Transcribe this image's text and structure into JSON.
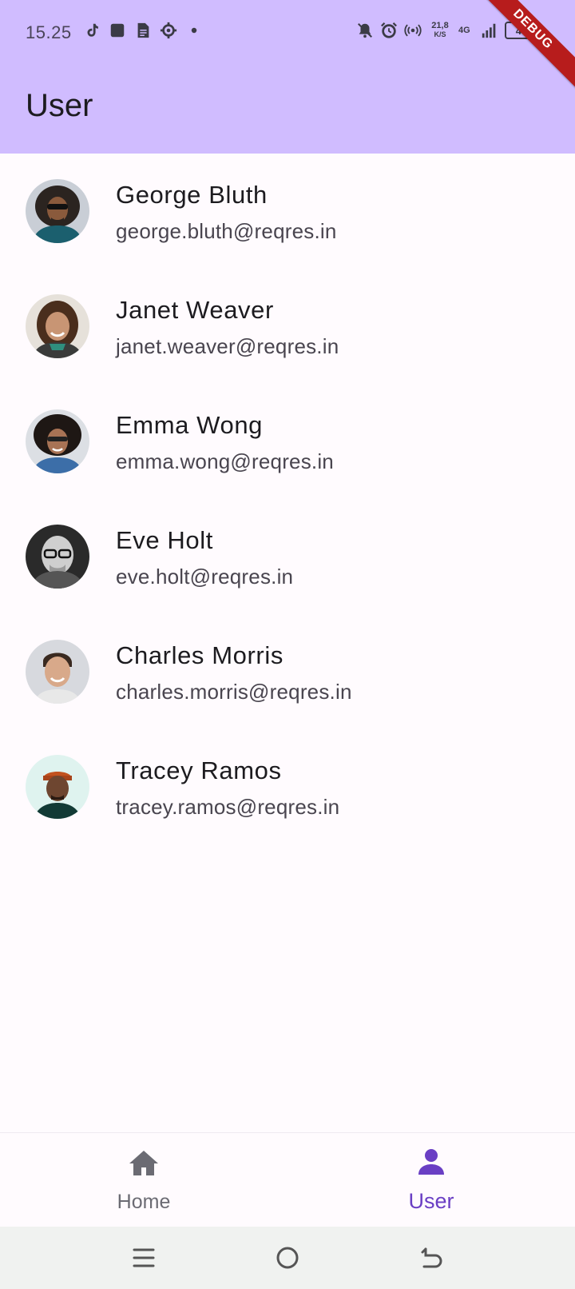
{
  "status_bar": {
    "time": "15.25",
    "net_speed_value": "21,8",
    "net_speed_unit": "K/S",
    "network_type": "4G",
    "battery": "44"
  },
  "debug_banner": "DEBUG",
  "app_bar": {
    "title": "User"
  },
  "users": [
    {
      "name": "George Bluth",
      "email": "george.bluth@reqres.in"
    },
    {
      "name": "Janet Weaver",
      "email": "janet.weaver@reqres.in"
    },
    {
      "name": "Emma Wong",
      "email": "emma.wong@reqres.in"
    },
    {
      "name": "Eve Holt",
      "email": "eve.holt@reqres.in"
    },
    {
      "name": "Charles Morris",
      "email": "charles.morris@reqres.in"
    },
    {
      "name": "Tracey Ramos",
      "email": "tracey.ramos@reqres.in"
    }
  ],
  "bottom_nav": {
    "items": [
      {
        "label": "Home",
        "icon": "home-icon",
        "selected": false
      },
      {
        "label": "User",
        "icon": "person-icon",
        "selected": true
      }
    ]
  },
  "colors": {
    "app_bar": "#d0bcff",
    "accent": "#6a3fc4",
    "debug": "#b71c1c"
  }
}
